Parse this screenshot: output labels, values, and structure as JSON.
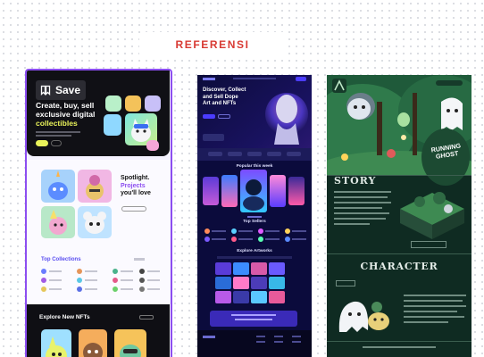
{
  "header": {
    "title": "REFERENSI"
  },
  "cards": [
    {
      "save_label": "Save",
      "hero": {
        "line1": "Create, buy, sell",
        "line2": "exclusive digital",
        "line3": "collectibles"
      },
      "spotlight": {
        "line1": "Spotlight.",
        "line2": "Projects",
        "line3": "you'll love"
      },
      "collections_title": "Top Collections",
      "explore_title": "Explore New NFTs"
    },
    {
      "hero": {
        "line1": "Discover, Collect",
        "line2": "and Sell Dope",
        "line3": "Art and NFTs"
      },
      "popular_title": "Popular this week",
      "sellers_title": "Top Sellers",
      "artworks_title": "Explore Artworks"
    },
    {
      "title": {
        "line1": "RUNNING",
        "line2": "GHOST"
      },
      "story_title": "STORY",
      "character_title": "CHARACTER"
    }
  ],
  "colors": {
    "accent": "#8c4ef0",
    "header_red": "#d83a33",
    "ghost_green": "#0f2b22",
    "nft_navy": "#0b0b3c"
  }
}
